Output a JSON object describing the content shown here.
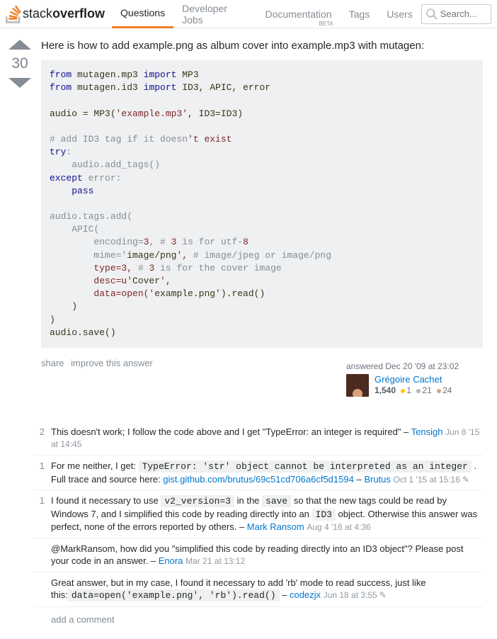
{
  "brand": {
    "part1": "stack",
    "part2": "overflow"
  },
  "nav": [
    "Questions",
    "Developer Jobs",
    "Documentation",
    "Tags",
    "Users"
  ],
  "nav_beta": "BETA",
  "search_placeholder": "Search...",
  "vote_score": "30",
  "answer_text": "Here is how to add example.png as album cover into example.mp3 with mutagen:",
  "code": "from mutagen.mp3 import MP3\nfrom mutagen.id3 import ID3, APIC, error\n\naudio = MP3('example.mp3', ID3=ID3)\n\n# add ID3 tag if it doesn't exist\ntry:\n    audio.add_tags()\nexcept error:\n    pass\n\naudio.tags.add(\n    APIC(\n        encoding=3, # 3 is for utf-8\n        mime='image/png', # image/jpeg or image/png\n        type=3, # 3 is for the cover image\n        desc=u'Cover',\n        data=open('example.png').read()\n    )\n)\naudio.save()",
  "post_links": {
    "share": "share",
    "improve": "improve this answer"
  },
  "usercard": {
    "action": "answered Dec 20 '09 at 23:02",
    "name": "Grégoire Cachet",
    "rep": "1,540",
    "gold": "1",
    "silver": "21",
    "bronze": "24"
  },
  "comments": [
    {
      "score": "2",
      "body_parts": [
        "This doesn't work; I follow the code above and I get \"TypeError: an integer is required\" – "
      ],
      "user": "Tensigh",
      "time": "Jun 8 '15 at 14:45",
      "edited": false
    },
    {
      "score": "1",
      "body_parts": [
        "For me neither, I get: ",
        {
          "code": "TypeError: 'str' object cannot be interpreted as an integer"
        },
        " . Full trace and source here: ",
        {
          "link": "gist.github.com/brutus/69c51cd706a6cf5d1594"
        },
        " – "
      ],
      "user": "Brutus",
      "time": "Oct 1 '15 at 15:16",
      "edited": true
    },
    {
      "score": "1",
      "body_parts": [
        "I found it necessary to use ",
        {
          "code": "v2_version=3"
        },
        " in the ",
        {
          "code": "save"
        },
        " so that the new tags could be read by Windows 7, and I simplified this code by reading directly into an ",
        {
          "code": "ID3"
        },
        " object. Otherwise this answer was perfect, none of the errors reported by others. – "
      ],
      "user": "Mark Ransom",
      "time": "Aug 4 '16 at 4:36",
      "edited": false
    },
    {
      "score": "",
      "body_parts": [
        "@MarkRansom, how did you \"simplified this code by reading directly into an ID3 object\"? Please post your code in an answer. – "
      ],
      "user": "Enora",
      "time": "Mar 21 at 13:12",
      "edited": false
    },
    {
      "score": "",
      "body_parts": [
        "Great answer, but in my case, I found it necessary to add 'rb' mode to read success, just like this:",
        {
          "code": "data=open('example.png', 'rb').read()"
        },
        " – "
      ],
      "user": "codezjx",
      "time": "Jun 18 at 3:55",
      "edited": true
    }
  ],
  "add_comment": "add a comment"
}
